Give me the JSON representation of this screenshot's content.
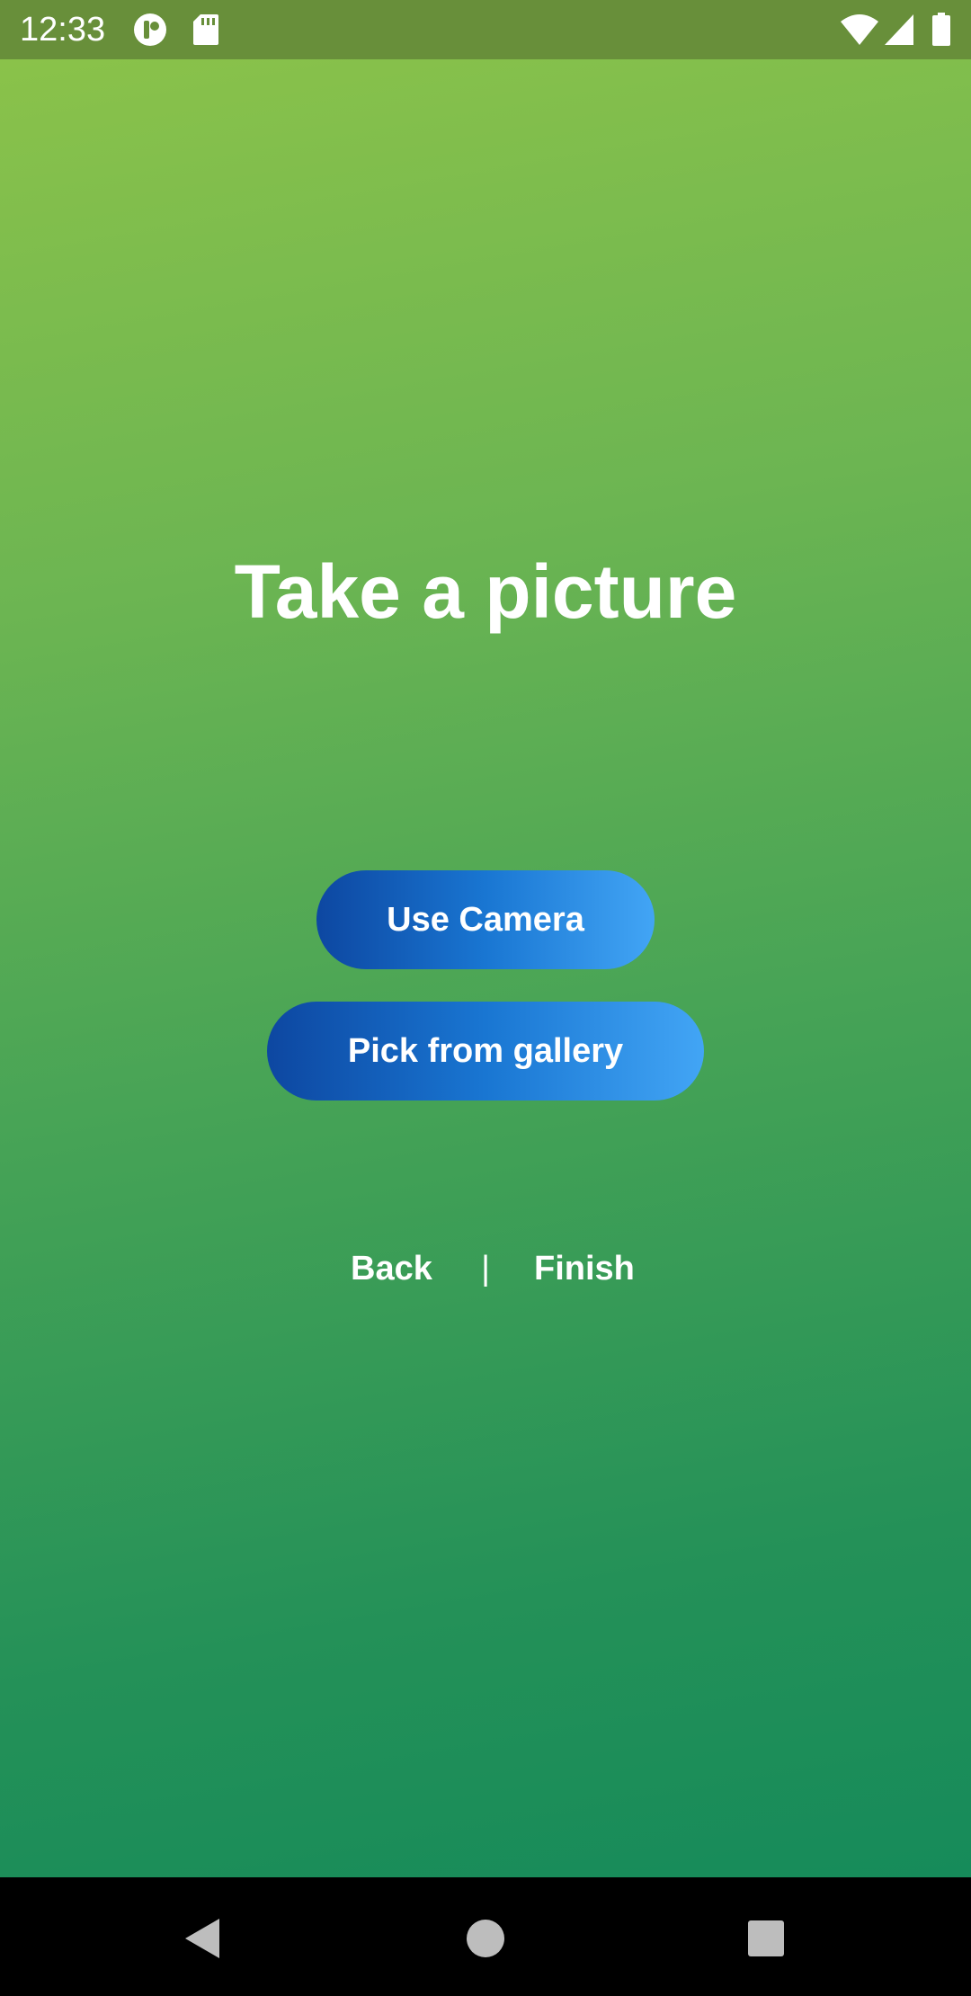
{
  "status_bar": {
    "time": "12:33",
    "left_icons": [
      "app-notification-icon",
      "sd-card-icon"
    ],
    "right_icons": [
      "wifi-icon",
      "signal-icon",
      "battery-icon"
    ]
  },
  "main": {
    "title": "Take a picture",
    "use_camera_label": "Use Camera",
    "pick_gallery_label": "Pick from gallery",
    "back_label": "Back",
    "separator": "|",
    "finish_label": "Finish"
  },
  "nav_bar": {
    "icons": [
      "back-triangle-icon",
      "home-circle-icon",
      "recents-square-icon"
    ]
  },
  "colors": {
    "status_bar": "#688f3a",
    "gradient_top": "#8ac24a",
    "gradient_bottom": "#168b5a",
    "button_start": "#0d47a1",
    "button_end": "#42a5f5",
    "text": "#ffffff"
  }
}
